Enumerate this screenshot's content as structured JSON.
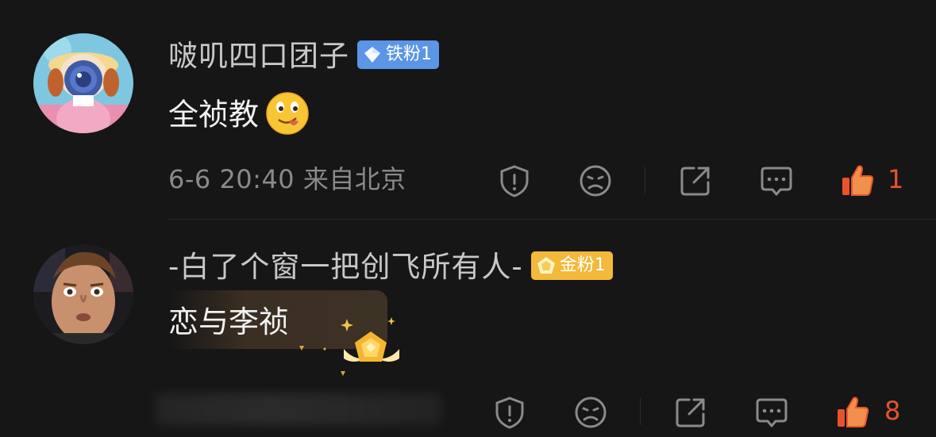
{
  "comments": [
    {
      "username": "啵叽四口团子",
      "badge": "铁粉1",
      "badge_color": "#5b95e6",
      "content": "全祯教",
      "emoji": "yum-face-emoji",
      "time": "6-6 20:40",
      "location": "来自北京",
      "likes": "1"
    },
    {
      "username": "-白了个窗一把创飞所有人-",
      "badge": "金粉1",
      "badge_color": "#f2b93b",
      "content": "恋与李祯",
      "likes": "8"
    }
  ],
  "colors": {
    "background": "#161616",
    "like_accent": "#e8532b",
    "meta_text": "#8a8a8a"
  },
  "icons": [
    "report-icon",
    "dislike-face-icon",
    "share-icon",
    "reply-icon",
    "like-icon"
  ]
}
